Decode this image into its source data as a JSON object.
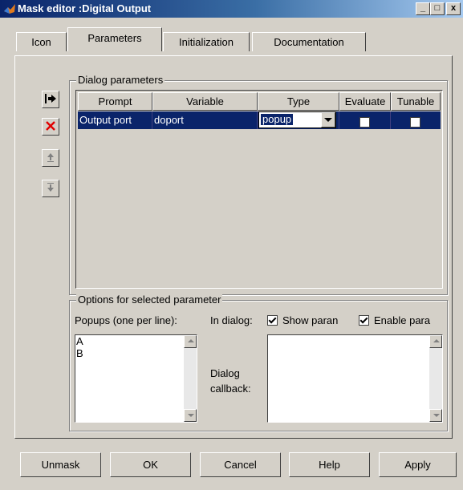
{
  "window": {
    "title": "Mask editor :Digital Output"
  },
  "window_controls": {
    "minimize": "_",
    "maximize": "□",
    "close": "x"
  },
  "tabs": [
    {
      "label": "Icon",
      "active": false
    },
    {
      "label": "Parameters",
      "active": true
    },
    {
      "label": "Initialization",
      "active": false
    },
    {
      "label": "Documentation",
      "active": false
    }
  ],
  "dialog_parameters": {
    "legend": "Dialog parameters",
    "toolbar": [
      "add-parameter-icon",
      "delete-parameter-icon",
      "move-up-icon",
      "move-down-icon"
    ],
    "columns": [
      "Prompt",
      "Variable",
      "Type",
      "Evaluate",
      "Tunable"
    ],
    "rows": [
      {
        "prompt": "Output port",
        "variable": "doport",
        "type": "popup",
        "evaluate": false,
        "tunable": false
      }
    ]
  },
  "options": {
    "legend": "Options for selected parameter",
    "popups_label": "Popups (one per line):",
    "popups_lines": [
      "A",
      "B"
    ],
    "in_dialog_label": "In dialog:",
    "show_param_label": "Show paran",
    "show_param_checked": true,
    "enable_param_label": "Enable para",
    "enable_param_checked": true,
    "callback_label_line1": "Dialog",
    "callback_label_line2": "callback:",
    "callback_value": ""
  },
  "buttons": {
    "unmask": "Unmask",
    "ok": "OK",
    "cancel": "Cancel",
    "help": "Help",
    "apply": "Apply"
  },
  "colors": {
    "face": "#d4d0c8",
    "selection": "#0a246a",
    "delete_red": "#e00000"
  }
}
